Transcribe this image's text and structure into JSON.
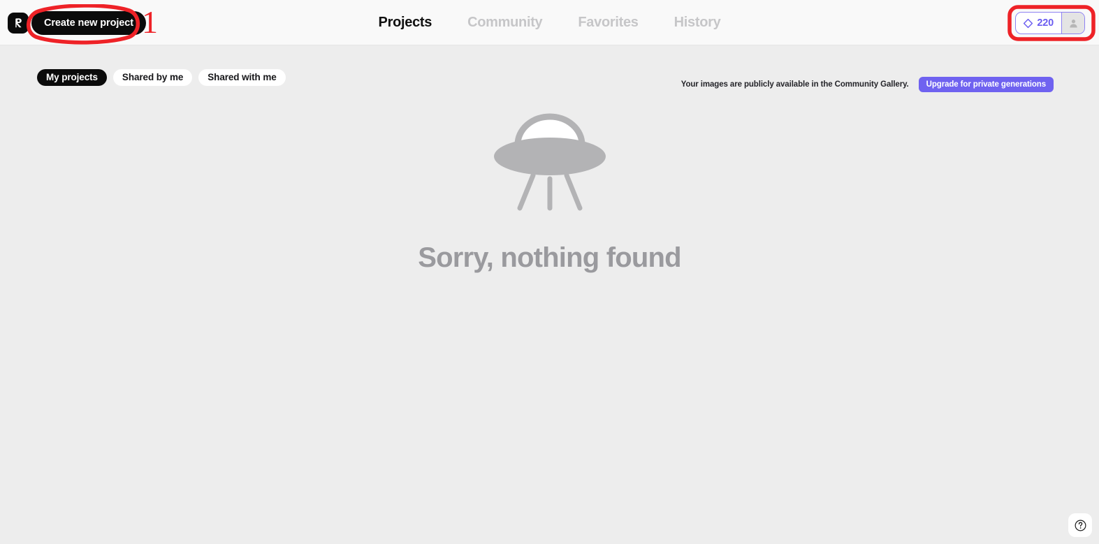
{
  "header": {
    "logo_icon": "recraft-logo-icon",
    "create_button": "Create new project",
    "nav": [
      {
        "label": "Projects",
        "active": true
      },
      {
        "label": "Community",
        "active": false
      },
      {
        "label": "Favorites",
        "active": false
      },
      {
        "label": "History",
        "active": false
      }
    ],
    "credits": {
      "icon": "diamond-credit-icon",
      "value": "220"
    },
    "avatar_icon": "user-avatar-icon"
  },
  "toolbar": {
    "chips": [
      {
        "label": "My projects",
        "active": true
      },
      {
        "label": "Shared by me",
        "active": false
      },
      {
        "label": "Shared with me",
        "active": false
      }
    ],
    "notice": "Your images are publicly available in the Community Gallery.",
    "upgrade_button": "Upgrade for private generations"
  },
  "empty_state": {
    "illustration": "ufo-icon",
    "title": "Sorry, nothing found"
  },
  "help": {
    "icon": "question-mark-circle-icon"
  },
  "annotations": {
    "step_number": "1",
    "color": "#ee2227"
  },
  "colors": {
    "accent_purple": "#6f62f0",
    "credit_purple": "#6a5cf0",
    "page_background": "#ededed",
    "header_background": "#f9f9f9",
    "dark": "#0b0b0b",
    "muted_gray": "#9a9a9e",
    "annotation_red": "#ee2227"
  }
}
